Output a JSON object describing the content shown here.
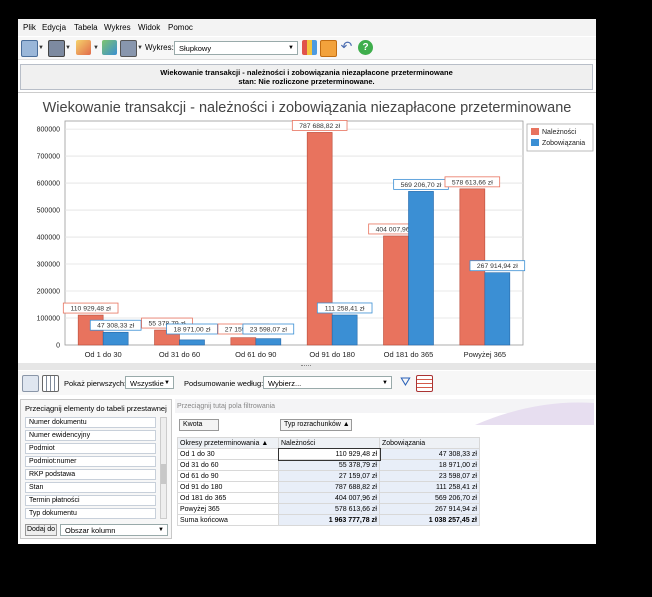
{
  "menu": [
    "Plik",
    "Edycja",
    "Tabela",
    "Wykres",
    "Widok",
    "Pomoc"
  ],
  "toolbar": {
    "wykres_label": "Wykres:",
    "chart_type": "Słupkowy"
  },
  "header": {
    "line1": "Wiekowanie transakcji - należności i zobowiązania niezapłacone przeterminowane",
    "line2": "stan: Nie rozliczone przeterminowane."
  },
  "chart_data": {
    "type": "bar",
    "title": "Wiekowanie transakcji - należności i zobowiązania niezapłacone przeterminowane",
    "categories": [
      "Od 1 do 30",
      "Od 31 do 60",
      "Od 61 do 90",
      "Od 91 do 180",
      "Od 181 do 365",
      "Powyżej 365"
    ],
    "series": [
      {
        "name": "Należności",
        "color": "#e8735e",
        "values": [
          110929.48,
          55378.79,
          27159.07,
          787688.82,
          404007.96,
          578613.66
        ],
        "labels": [
          "110 929,48 zł",
          "55 378,79 zł",
          "27 159,07 zł",
          "787 688,82 zł",
          "404 007,96 zł",
          "578 613,66 zł"
        ]
      },
      {
        "name": "Zobowiązania",
        "color": "#3b8fd4",
        "values": [
          47308.33,
          18971.0,
          23598.07,
          111258.41,
          569206.7,
          267914.94
        ],
        "labels": [
          "47 308,33 zł",
          "18 971,00 zł",
          "23 598,07 zł",
          "111 258,41 zł",
          "569 206,70 zł",
          "267 914,94 zł"
        ]
      }
    ],
    "yticks": [
      "0",
      "100000",
      "200000",
      "300000",
      "400000",
      "500000",
      "600000",
      "700000",
      "800000"
    ],
    "ylim": [
      0,
      830000
    ],
    "grid": true,
    "legend": "top-right"
  },
  "filter": {
    "pokaz_label": "Pokaż pierwszych:",
    "pokaz_value": "Wszystkie",
    "podsum_label": "Podsumowanie według:",
    "podsum_value": "Wybierz..."
  },
  "fields": {
    "title": "Przeciągnij elementy do tabeli przestawnej",
    "items": [
      "Numer dokumentu",
      "Numer ewidencyjny",
      "Podmiot",
      "Podmiot:numer",
      "RKP podstawa",
      "Stan",
      "Termin płatności",
      "Typ dokumentu"
    ],
    "add_button": "Dodaj do",
    "add_target": "Obszar kolumn"
  },
  "pivot": {
    "drop_hint": "Przeciągnij tutaj pola filtrowania",
    "data_field": "Kwota",
    "column_field": "Typ rozrachunków",
    "row_field": "Okresy przeterminowania",
    "col_headers": [
      "Należności",
      "Zobowiązania"
    ],
    "rows": [
      {
        "label": "Od 1 do 30",
        "v1": "110 929,48 zł",
        "v2": "47 308,33 zł"
      },
      {
        "label": "Od 31 do 60",
        "v1": "55 378,79 zł",
        "v2": "18 971,00 zł"
      },
      {
        "label": "Od 61 do 90",
        "v1": "27 159,07 zł",
        "v2": "23 598,07 zł"
      },
      {
        "label": "Od 91 do 180",
        "v1": "787 688,82 zł",
        "v2": "111 258,41 zł"
      },
      {
        "label": "Od 181 do 365",
        "v1": "404 007,96 zł",
        "v2": "569 206,70 zł"
      },
      {
        "label": "Powyżej 365",
        "v1": "578 613,66 zł",
        "v2": "267 914,94 zł"
      }
    ],
    "total": {
      "label": "Suma końcowa",
      "v1": "1 963 777,78 zł",
      "v2": "1 038 257,45 zł"
    }
  }
}
